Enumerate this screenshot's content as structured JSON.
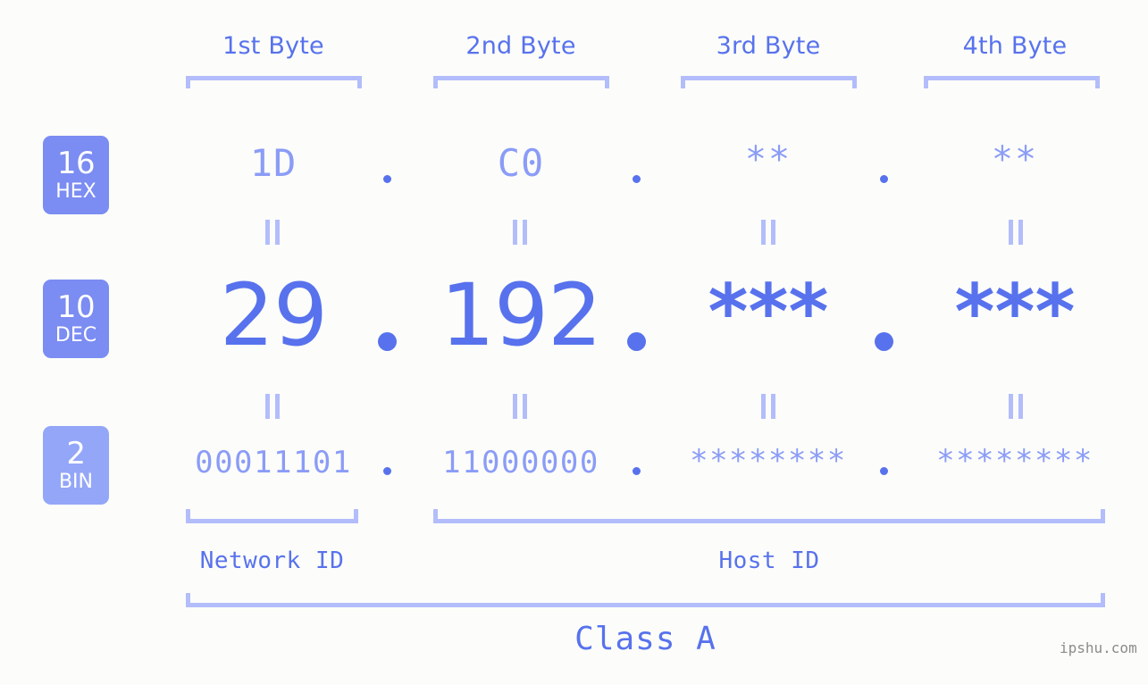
{
  "theme": {
    "background": "#fcfdfa",
    "accent_strong": "#5872ed",
    "accent_light": "#8b9cf7",
    "accent_pale": "#b3bdfb",
    "badge_strong": "#7b8cf2",
    "badge_light": "#93a6f8",
    "watermark_color": "#8c8c8c"
  },
  "headers": {
    "byte1": "1st Byte",
    "byte2": "2nd Byte",
    "byte3": "3rd Byte",
    "byte4": "4th Byte"
  },
  "bases": [
    {
      "number": "16",
      "abbr": "HEX"
    },
    {
      "number": "10",
      "abbr": "DEC"
    },
    {
      "number": "2",
      "abbr": "BIN"
    }
  ],
  "rows": {
    "hex": {
      "byte1": "1D",
      "byte2": "C0",
      "byte3": "**",
      "byte4": "**"
    },
    "dec": {
      "byte1": "29",
      "byte2": "192",
      "byte3": "***",
      "byte4": "***"
    },
    "bin": {
      "byte1": "00011101",
      "byte2": "11000000",
      "byte3": "********",
      "byte4": "********"
    }
  },
  "separators": {
    "dot": "."
  },
  "equals_marks": {
    "symbol": "="
  },
  "footer": {
    "network_id": "Network ID",
    "host_id": "Host ID",
    "class": "Class A",
    "watermark": "ipshu.com"
  }
}
